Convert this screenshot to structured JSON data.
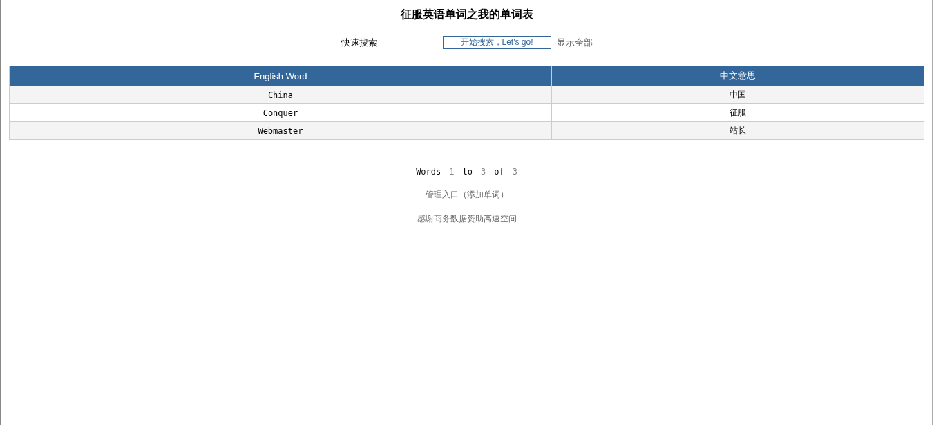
{
  "title": "征服英语单词之我的单词表",
  "search": {
    "label": "快速搜索",
    "button": "开始搜索，Let's go!",
    "show_all": "显示全部"
  },
  "table": {
    "columns": [
      "English Word",
      "中文意思"
    ],
    "rows": [
      [
        "China",
        "中国"
      ],
      [
        "Conquer",
        "征服"
      ],
      [
        "Webmaster",
        "站长"
      ]
    ]
  },
  "pager": [
    {
      "text": "Words",
      "kind": "word"
    },
    {
      "text": "1",
      "kind": "number"
    },
    {
      "text": "to",
      "kind": "word"
    },
    {
      "text": "3",
      "kind": "number"
    },
    {
      "text": "of",
      "kind": "word"
    },
    {
      "text": "3",
      "kind": "number"
    }
  ],
  "admin_link": "管理入口（添加单词）",
  "thanks_link": "感谢商务数据赞助高速空间"
}
